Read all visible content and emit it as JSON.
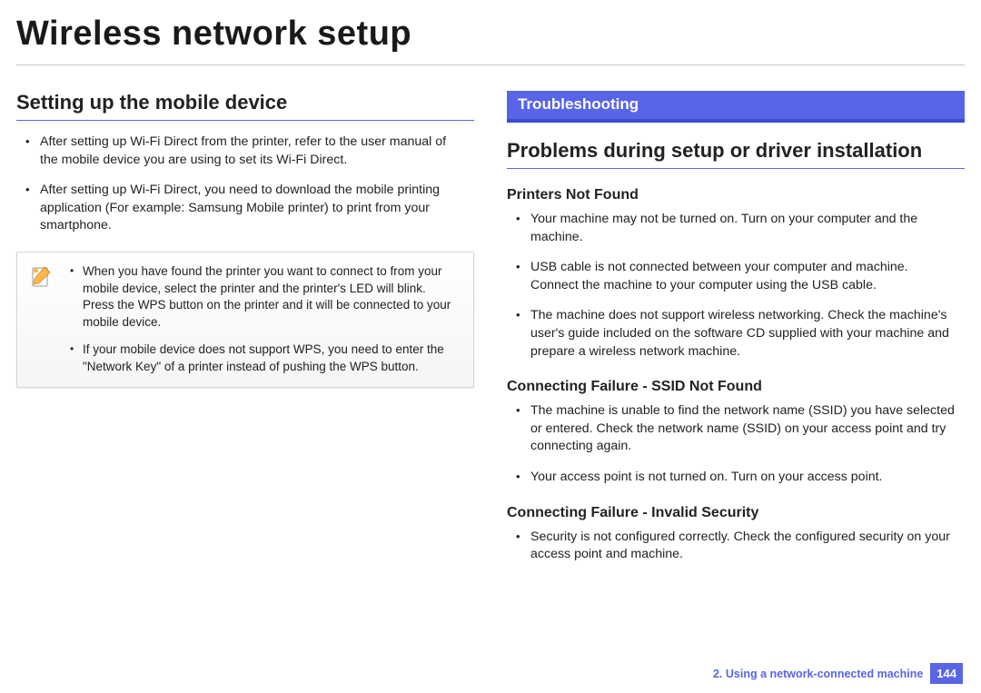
{
  "pageTitle": "Wireless network setup",
  "left": {
    "heading": "Setting up the mobile device",
    "bullets": [
      "After setting up Wi-Fi Direct from the printer, refer to the user manual of the mobile device you are using to set its Wi-Fi Direct.",
      "After setting up Wi-Fi Direct, you need to download the mobile printing application (For example: Samsung Mobile printer) to print from your smartphone."
    ],
    "note": [
      "When you have found the printer you want to connect to from your mobile device, select the printer and the printer's LED will blink. Press the WPS button on the printer and it will be connected to your mobile device.",
      "If your mobile device does not support WPS, you need to enter the \"Network Key\" of a printer instead of pushing the WPS button."
    ]
  },
  "right": {
    "bar": "Troubleshooting",
    "heading": "Problems during setup or driver installation",
    "sections": [
      {
        "title": "Printers Not Found",
        "bullets": [
          "Your machine may not be turned on. Turn on your computer and the machine.",
          "USB cable is not connected between your computer and machine. Connect the machine to your computer using the USB cable.",
          "The machine does not support wireless networking. Check the machine's user's guide included on the software CD supplied with your machine and prepare a wireless network machine."
        ]
      },
      {
        "title": "Connecting Failure - SSID Not Found",
        "bullets": [
          "The machine is unable to find the network name (SSID) you have selected or entered. Check the network name (SSID) on your access point and try connecting again.",
          "Your access point is not turned on. Turn on your access point."
        ]
      },
      {
        "title": "Connecting Failure - Invalid Security",
        "bullets": [
          "Security is not configured correctly. Check the configured security on your access point and machine."
        ]
      }
    ]
  },
  "footer": {
    "chapter": "2.  Using a network-connected machine",
    "page": "144"
  }
}
